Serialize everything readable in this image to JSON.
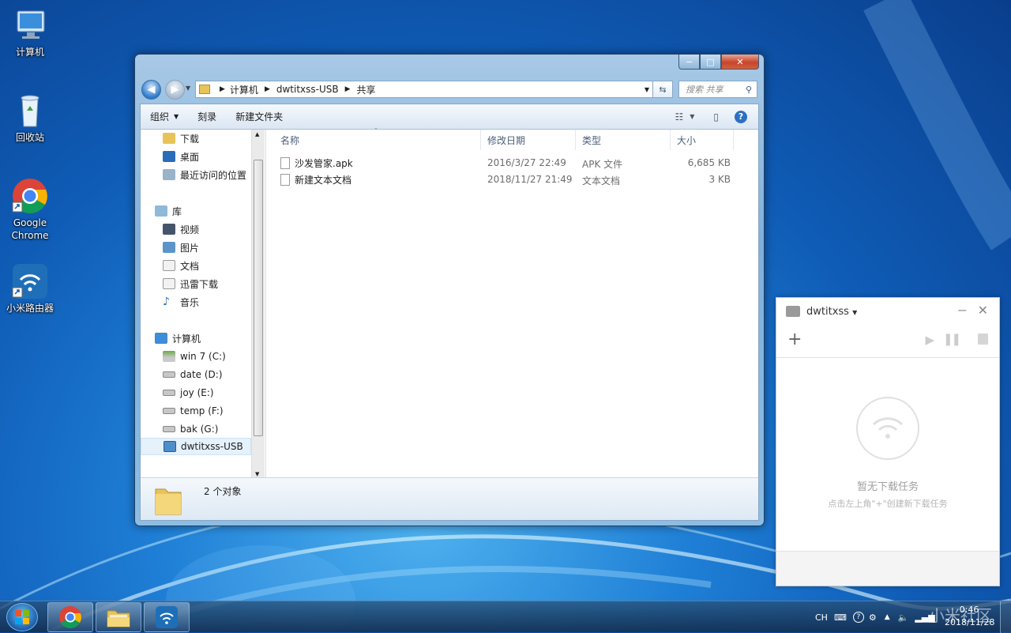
{
  "desktop": {
    "icons": [
      {
        "label": "计算机"
      },
      {
        "label": "回收站"
      },
      {
        "label": "Google Chrome"
      },
      {
        "label": "小米路由器"
      }
    ]
  },
  "explorer": {
    "caption_buttons": {
      "minimize": "−",
      "maximize": "□",
      "close": "✕"
    },
    "breadcrumb": [
      "计算机",
      "dwtitxss-USB",
      "共享"
    ],
    "search_placeholder": "搜索 共享",
    "toolbar": {
      "organize": "组织",
      "burn": "刻录",
      "new_folder": "新建文件夹"
    },
    "nav_items": [
      "下载",
      "桌面",
      "最近访问的位置",
      "库",
      "视频",
      "图片",
      "文档",
      "迅雷下载",
      "音乐",
      "计算机",
      "win 7 (C:)",
      "date (D:)",
      "joy (E:)",
      "temp (F:)",
      "bak (G:)",
      "dwtitxss-USB"
    ],
    "selected_nav": "dwtitxss-USB",
    "columns": [
      "名称",
      "修改日期",
      "类型",
      "大小"
    ],
    "files": [
      {
        "name": "沙发管家.apk",
        "modified": "2016/3/27 22:49",
        "type": "APK 文件",
        "size": "6,685 KB"
      },
      {
        "name": "新建文本文档",
        "modified": "2018/11/27 21:49",
        "type": "文本文档",
        "size": "3 KB"
      }
    ],
    "status": "2 个对象"
  },
  "xiaomi_panel": {
    "title": "dwtitxss",
    "empty_title": "暂无下载任务",
    "empty_hint": "点击左上角\"+\"创建新下载任务"
  },
  "taskbar": {
    "lang": "CH",
    "time": "0:46",
    "date": "2018/11/28",
    "watermark": "小米社区"
  },
  "colors": {
    "accent": "#1f7fd6",
    "selection": "#cce8ff",
    "close": "#c7452c"
  }
}
